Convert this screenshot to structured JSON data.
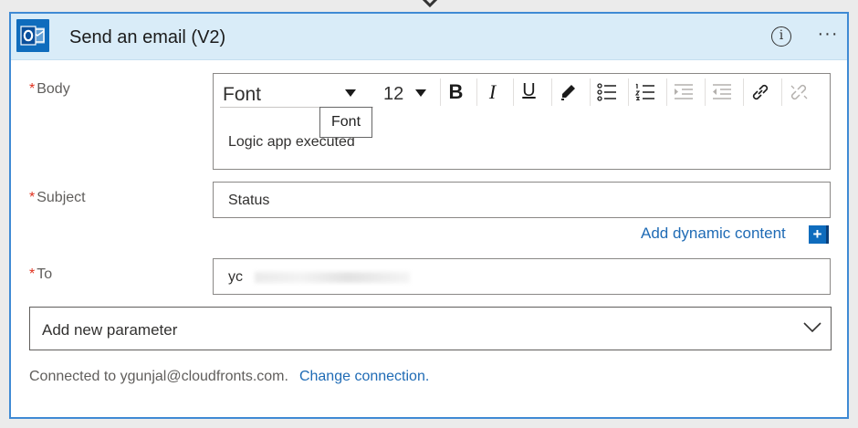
{
  "header": {
    "title": "Send an email (V2)",
    "info_symbol": "i",
    "more_symbol": "···"
  },
  "fields": {
    "body": {
      "label": "Body",
      "required_mark": "*",
      "font_value": "Font",
      "size_value": "12",
      "tooltip": "Font",
      "content": "Logic app executed"
    },
    "subject": {
      "label": "Subject",
      "required_mark": "*",
      "value": "Status"
    },
    "to": {
      "label": "To",
      "required_mark": "*",
      "value_visible": "yc"
    }
  },
  "toolbar": {
    "bold": "B",
    "italic": "I",
    "underline": "U"
  },
  "dynamic_content": {
    "label": "Add dynamic content",
    "plus": "+"
  },
  "add_parameter": {
    "label": "Add new parameter"
  },
  "footer": {
    "connected_text": "Connected to ygunjal@cloudfronts.com.",
    "change_link": "Change connection."
  },
  "colors": {
    "accent": "#0f6cbd",
    "header_bg": "#d9ecf8",
    "card_border": "#3f8ad4",
    "required": "#e0301e",
    "link": "#1f6bb5"
  }
}
